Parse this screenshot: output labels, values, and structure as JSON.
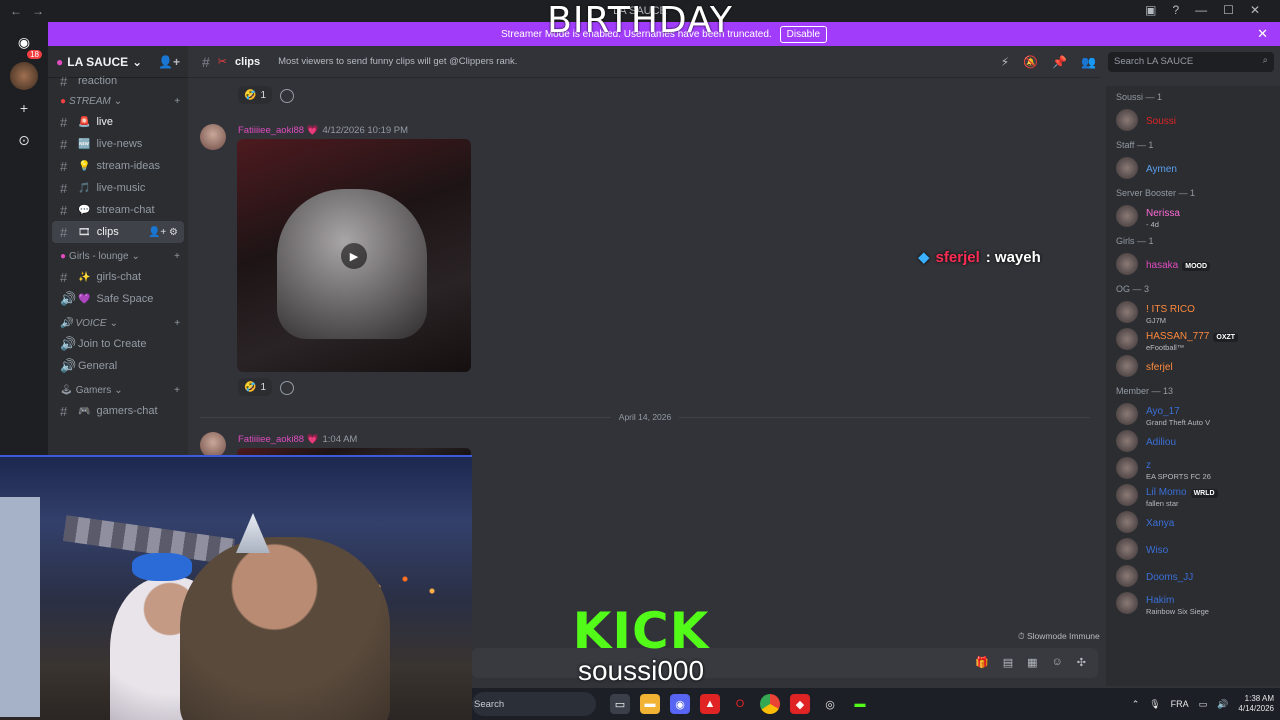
{
  "window": {
    "title": "LA SAUCE"
  },
  "overlay_text": "BIRTHDAY",
  "streamer_banner": {
    "text": "Streamer Mode is enabled. Usernames have been truncated.",
    "button": "Disable"
  },
  "rail": {
    "badge": "18"
  },
  "server": {
    "name": "LA SAUCE"
  },
  "sidebar": {
    "top_channel": "reaction",
    "categories": [
      {
        "name": "STREAM",
        "channels": [
          {
            "icon": "🚨",
            "name": "live"
          },
          {
            "icon": "🆕",
            "name": "live-news"
          },
          {
            "icon": "💡",
            "name": "stream-ideas"
          },
          {
            "icon": "🎵",
            "name": "live-music"
          },
          {
            "icon": "💬",
            "name": "stream-chat"
          },
          {
            "icon": "🎞",
            "name": "clips"
          }
        ]
      },
      {
        "name": "Girls - lounge",
        "channels": [
          {
            "icon": "✨",
            "name": "girls-chat"
          },
          {
            "icon": "💜",
            "name": "Safe Space"
          }
        ]
      },
      {
        "name": "VOICE",
        "channels": [
          {
            "icon": "",
            "name": "Join to Create"
          },
          {
            "icon": "",
            "name": "General"
          }
        ]
      },
      {
        "name": "Gamers",
        "channels": [
          {
            "icon": "🎮",
            "name": "gamers-chat"
          }
        ]
      }
    ]
  },
  "chat": {
    "channel": "clips",
    "topic": "Most viewers to send funny clips will get @Clippers rank.",
    "reaction_count": "1",
    "messages": [
      {
        "author": "Fatiiiiee_aoki88",
        "timestamp": "4/12/2026 10:19 PM"
      },
      {
        "author": "Fatiiiiee_aoki88",
        "timestamp": "1:04 AM"
      }
    ],
    "date_divider": "April 14, 2026",
    "floating_name": "sferjel",
    "floating_text": ": wayeh",
    "slowmode": "Slowmode Immune"
  },
  "search": {
    "placeholder": "Search LA SAUCE"
  },
  "members": {
    "groups": [
      {
        "label": "Soussi — 1",
        "members": [
          {
            "name": "Soussi",
            "color": "#e02424",
            "activity": ""
          }
        ]
      },
      {
        "label": "Staff — 1",
        "members": [
          {
            "name": "Aymen",
            "color": "#5aa0f0",
            "activity": ""
          }
        ]
      },
      {
        "label": "Server Booster — 1",
        "members": [
          {
            "name": "Nerissa",
            "color": "#ff6ad5",
            "activity": "- 4d"
          }
        ]
      },
      {
        "label": "Girls — 1",
        "members": [
          {
            "name": "hasaka",
            "color": "#e04cc0",
            "activity": "",
            "tag": "MOOD"
          }
        ]
      },
      {
        "label": "OG — 3",
        "members": [
          {
            "name": "! ITS RICO",
            "color": "#ff8a3d",
            "activity": "GJ7M"
          },
          {
            "name": "HASSAN_777",
            "color": "#ff8a3d",
            "activity": "eFootball™",
            "tag": "OXZT"
          },
          {
            "name": "sferjel",
            "color": "#ff8a3d",
            "activity": ""
          }
        ]
      },
      {
        "label": "Member — 13",
        "members": [
          {
            "name": "Ayo_17",
            "color": "#3b6fd8",
            "activity": "Grand Theft Auto V"
          },
          {
            "name": "Adiliou",
            "color": "#3b6fd8",
            "activity": ""
          },
          {
            "name": "z",
            "color": "#3b6fd8",
            "activity": "EA SPORTS FC 26"
          },
          {
            "name": "Lil Momo",
            "color": "#3b6fd8",
            "activity": "fallen star",
            "tag": "WRLD"
          },
          {
            "name": "Xanya",
            "color": "#3b6fd8",
            "activity": ""
          },
          {
            "name": "Wiso",
            "color": "#3b6fd8",
            "activity": ""
          },
          {
            "name": "Dooms_JJ",
            "color": "#3b6fd8",
            "activity": ""
          },
          {
            "name": "Hakim",
            "color": "#3b6fd8",
            "activity": "Rainbow Six Siege"
          }
        ]
      }
    ]
  },
  "kick": {
    "logo": "KICK",
    "username": "soussi000"
  },
  "taskbar": {
    "search": "Search",
    "lang": "FRA",
    "time": "1:38 AM",
    "date": "4/14/2026"
  }
}
